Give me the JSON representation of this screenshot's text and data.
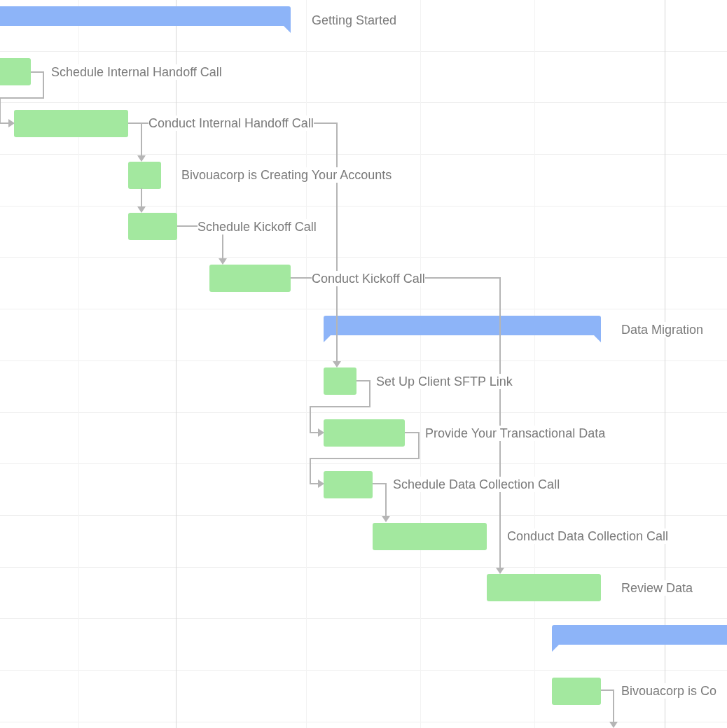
{
  "gantt": {
    "rows": [
      {
        "kind": "summary",
        "label": "Getting Started"
      },
      {
        "kind": "task",
        "label": "Schedule Internal Handoff Call"
      },
      {
        "kind": "task",
        "label": "Conduct Internal Handoff Call"
      },
      {
        "kind": "task",
        "label": "Bivouacorp is Creating Your Accounts"
      },
      {
        "kind": "task",
        "label": "Schedule Kickoff Call"
      },
      {
        "kind": "task",
        "label": "Conduct Kickoff Call"
      },
      {
        "kind": "summary",
        "label": "Data Migration"
      },
      {
        "kind": "task",
        "label": "Set Up Client SFTP Link"
      },
      {
        "kind": "task",
        "label": "Provide Your Transactional Data"
      },
      {
        "kind": "task",
        "label": "Schedule Data Collection Call"
      },
      {
        "kind": "task",
        "label": "Conduct Data Collection Call"
      },
      {
        "kind": "task",
        "label": "Review Data"
      },
      {
        "kind": "summary"
      },
      {
        "kind": "task",
        "label": "Bivouacorp is Co"
      },
      {
        "kind": "task"
      }
    ]
  }
}
